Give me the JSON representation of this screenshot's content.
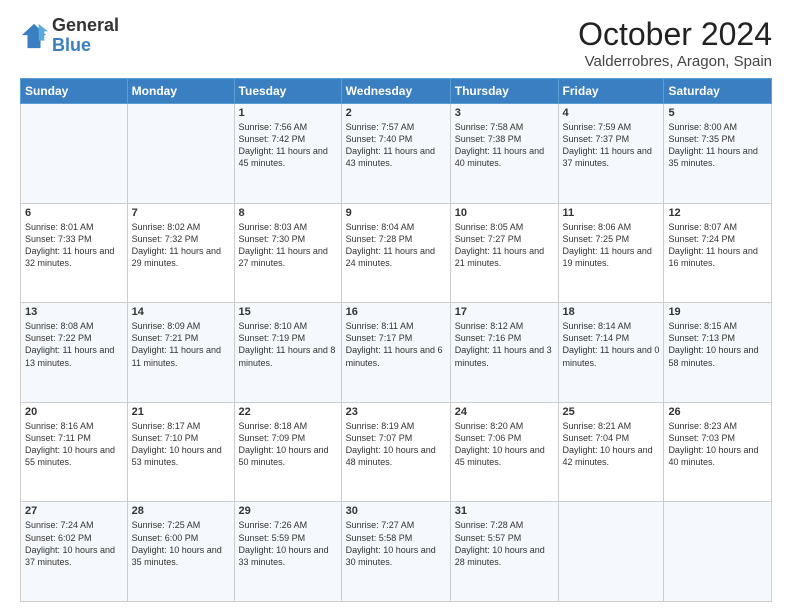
{
  "logo": {
    "general": "General",
    "blue": "Blue"
  },
  "title": "October 2024",
  "location": "Valderrobres, Aragon, Spain",
  "headers": [
    "Sunday",
    "Monday",
    "Tuesday",
    "Wednesday",
    "Thursday",
    "Friday",
    "Saturday"
  ],
  "weeks": [
    [
      {
        "day": "",
        "sunrise": "",
        "sunset": "",
        "daylight": ""
      },
      {
        "day": "",
        "sunrise": "",
        "sunset": "",
        "daylight": ""
      },
      {
        "day": "1",
        "sunrise": "Sunrise: 7:56 AM",
        "sunset": "Sunset: 7:42 PM",
        "daylight": "Daylight: 11 hours and 45 minutes."
      },
      {
        "day": "2",
        "sunrise": "Sunrise: 7:57 AM",
        "sunset": "Sunset: 7:40 PM",
        "daylight": "Daylight: 11 hours and 43 minutes."
      },
      {
        "day": "3",
        "sunrise": "Sunrise: 7:58 AM",
        "sunset": "Sunset: 7:38 PM",
        "daylight": "Daylight: 11 hours and 40 minutes."
      },
      {
        "day": "4",
        "sunrise": "Sunrise: 7:59 AM",
        "sunset": "Sunset: 7:37 PM",
        "daylight": "Daylight: 11 hours and 37 minutes."
      },
      {
        "day": "5",
        "sunrise": "Sunrise: 8:00 AM",
        "sunset": "Sunset: 7:35 PM",
        "daylight": "Daylight: 11 hours and 35 minutes."
      }
    ],
    [
      {
        "day": "6",
        "sunrise": "Sunrise: 8:01 AM",
        "sunset": "Sunset: 7:33 PM",
        "daylight": "Daylight: 11 hours and 32 minutes."
      },
      {
        "day": "7",
        "sunrise": "Sunrise: 8:02 AM",
        "sunset": "Sunset: 7:32 PM",
        "daylight": "Daylight: 11 hours and 29 minutes."
      },
      {
        "day": "8",
        "sunrise": "Sunrise: 8:03 AM",
        "sunset": "Sunset: 7:30 PM",
        "daylight": "Daylight: 11 hours and 27 minutes."
      },
      {
        "day": "9",
        "sunrise": "Sunrise: 8:04 AM",
        "sunset": "Sunset: 7:28 PM",
        "daylight": "Daylight: 11 hours and 24 minutes."
      },
      {
        "day": "10",
        "sunrise": "Sunrise: 8:05 AM",
        "sunset": "Sunset: 7:27 PM",
        "daylight": "Daylight: 11 hours and 21 minutes."
      },
      {
        "day": "11",
        "sunrise": "Sunrise: 8:06 AM",
        "sunset": "Sunset: 7:25 PM",
        "daylight": "Daylight: 11 hours and 19 minutes."
      },
      {
        "day": "12",
        "sunrise": "Sunrise: 8:07 AM",
        "sunset": "Sunset: 7:24 PM",
        "daylight": "Daylight: 11 hours and 16 minutes."
      }
    ],
    [
      {
        "day": "13",
        "sunrise": "Sunrise: 8:08 AM",
        "sunset": "Sunset: 7:22 PM",
        "daylight": "Daylight: 11 hours and 13 minutes."
      },
      {
        "day": "14",
        "sunrise": "Sunrise: 8:09 AM",
        "sunset": "Sunset: 7:21 PM",
        "daylight": "Daylight: 11 hours and 11 minutes."
      },
      {
        "day": "15",
        "sunrise": "Sunrise: 8:10 AM",
        "sunset": "Sunset: 7:19 PM",
        "daylight": "Daylight: 11 hours and 8 minutes."
      },
      {
        "day": "16",
        "sunrise": "Sunrise: 8:11 AM",
        "sunset": "Sunset: 7:17 PM",
        "daylight": "Daylight: 11 hours and 6 minutes."
      },
      {
        "day": "17",
        "sunrise": "Sunrise: 8:12 AM",
        "sunset": "Sunset: 7:16 PM",
        "daylight": "Daylight: 11 hours and 3 minutes."
      },
      {
        "day": "18",
        "sunrise": "Sunrise: 8:14 AM",
        "sunset": "Sunset: 7:14 PM",
        "daylight": "Daylight: 11 hours and 0 minutes."
      },
      {
        "day": "19",
        "sunrise": "Sunrise: 8:15 AM",
        "sunset": "Sunset: 7:13 PM",
        "daylight": "Daylight: 10 hours and 58 minutes."
      }
    ],
    [
      {
        "day": "20",
        "sunrise": "Sunrise: 8:16 AM",
        "sunset": "Sunset: 7:11 PM",
        "daylight": "Daylight: 10 hours and 55 minutes."
      },
      {
        "day": "21",
        "sunrise": "Sunrise: 8:17 AM",
        "sunset": "Sunset: 7:10 PM",
        "daylight": "Daylight: 10 hours and 53 minutes."
      },
      {
        "day": "22",
        "sunrise": "Sunrise: 8:18 AM",
        "sunset": "Sunset: 7:09 PM",
        "daylight": "Daylight: 10 hours and 50 minutes."
      },
      {
        "day": "23",
        "sunrise": "Sunrise: 8:19 AM",
        "sunset": "Sunset: 7:07 PM",
        "daylight": "Daylight: 10 hours and 48 minutes."
      },
      {
        "day": "24",
        "sunrise": "Sunrise: 8:20 AM",
        "sunset": "Sunset: 7:06 PM",
        "daylight": "Daylight: 10 hours and 45 minutes."
      },
      {
        "day": "25",
        "sunrise": "Sunrise: 8:21 AM",
        "sunset": "Sunset: 7:04 PM",
        "daylight": "Daylight: 10 hours and 42 minutes."
      },
      {
        "day": "26",
        "sunrise": "Sunrise: 8:23 AM",
        "sunset": "Sunset: 7:03 PM",
        "daylight": "Daylight: 10 hours and 40 minutes."
      }
    ],
    [
      {
        "day": "27",
        "sunrise": "Sunrise: 7:24 AM",
        "sunset": "Sunset: 6:02 PM",
        "daylight": "Daylight: 10 hours and 37 minutes."
      },
      {
        "day": "28",
        "sunrise": "Sunrise: 7:25 AM",
        "sunset": "Sunset: 6:00 PM",
        "daylight": "Daylight: 10 hours and 35 minutes."
      },
      {
        "day": "29",
        "sunrise": "Sunrise: 7:26 AM",
        "sunset": "Sunset: 5:59 PM",
        "daylight": "Daylight: 10 hours and 33 minutes."
      },
      {
        "day": "30",
        "sunrise": "Sunrise: 7:27 AM",
        "sunset": "Sunset: 5:58 PM",
        "daylight": "Daylight: 10 hours and 30 minutes."
      },
      {
        "day": "31",
        "sunrise": "Sunrise: 7:28 AM",
        "sunset": "Sunset: 5:57 PM",
        "daylight": "Daylight: 10 hours and 28 minutes."
      },
      {
        "day": "",
        "sunrise": "",
        "sunset": "",
        "daylight": ""
      },
      {
        "day": "",
        "sunrise": "",
        "sunset": "",
        "daylight": ""
      }
    ]
  ]
}
